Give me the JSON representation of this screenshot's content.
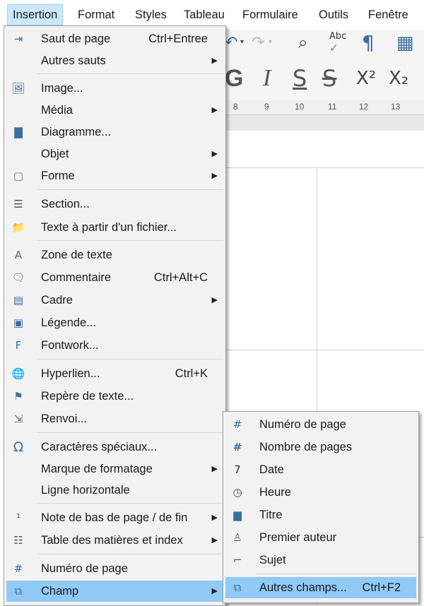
{
  "menubar": [
    "Insertion",
    "Format",
    "Styles",
    "Tableau",
    "Formulaire",
    "Outils",
    "Fenêtre"
  ],
  "toolbar": {
    "g": "G",
    "i": "I",
    "s": "S",
    "strike": "S",
    "sup": "X²",
    "sub": "X₂"
  },
  "ruler": [
    "8",
    "9",
    "10",
    "11",
    "12",
    "13"
  ],
  "insert_menu": [
    {
      "label": "Saut de page",
      "shortcut": "Ctrl+Entree",
      "icon": "page-break-icon"
    },
    {
      "label": "Autres sauts",
      "arrow": true
    },
    {
      "label": "Image...",
      "icon": "image-icon"
    },
    {
      "label": "Média",
      "arrow": true
    },
    {
      "label": "Diagramme...",
      "icon": "chart-icon"
    },
    {
      "label": "Objet",
      "arrow": true
    },
    {
      "label": "Forme",
      "arrow": true,
      "icon": "shape-icon"
    },
    {
      "label": "Section...",
      "icon": "section-icon"
    },
    {
      "label": "Texte à partir d'un fichier...",
      "icon": "folder-icon"
    },
    {
      "label": "Zone de texte",
      "icon": "textbox-icon"
    },
    {
      "label": "Commentaire",
      "shortcut": "Ctrl+Alt+C",
      "icon": "comment-icon"
    },
    {
      "label": "Cadre",
      "arrow": true,
      "icon": "frame-icon"
    },
    {
      "label": "Légende...",
      "icon": "caption-icon"
    },
    {
      "label": "Fontwork...",
      "icon": "fontwork-icon"
    },
    {
      "label": "Hyperlien...",
      "shortcut": "Ctrl+K",
      "icon": "hyperlink-icon"
    },
    {
      "label": "Repère de texte...",
      "icon": "bookmark-icon"
    },
    {
      "label": "Renvoi...",
      "icon": "cross-reference-icon"
    },
    {
      "label": "Caractères spéciaux...",
      "icon": "omega-icon"
    },
    {
      "label": "Marque de formatage",
      "arrow": true
    },
    {
      "label": "Ligne horizontale"
    },
    {
      "label": "Note de bas de page / de fin",
      "arrow": true,
      "icon": "footnote-icon"
    },
    {
      "label": "Table des matières et index",
      "arrow": true,
      "icon": "toc-icon"
    },
    {
      "label": "Numéro de page",
      "icon": "hash-icon"
    },
    {
      "label": "Champ",
      "arrow": true,
      "icon": "field-icon"
    }
  ],
  "field_submenu": [
    {
      "label": "Numéro de page",
      "icon": "page-number-icon"
    },
    {
      "label": "Nombre de pages",
      "icon": "page-count-icon"
    },
    {
      "label": "Date",
      "icon": "calendar-icon"
    },
    {
      "label": "Heure",
      "icon": "clock-icon"
    },
    {
      "label": "Titre",
      "icon": "document-title-icon"
    },
    {
      "label": "Premier auteur",
      "icon": "author-icon"
    },
    {
      "label": "Sujet",
      "icon": "subject-icon"
    },
    {
      "label": "Autres champs...",
      "shortcut": "Ctrl+F2",
      "icon": "more-fields-icon"
    }
  ]
}
